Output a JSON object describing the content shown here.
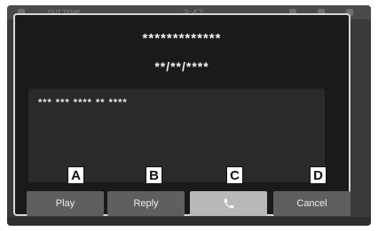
{
  "statusbar": {
    "out_temp": "OUT TEMP",
    "clock": "3:47"
  },
  "dialog": {
    "caller": "*************",
    "date": "**/**/****",
    "message": "*** *** **** ** ****"
  },
  "buttons": {
    "play": "Play",
    "reply": "Reply",
    "call_icon": "phone-icon",
    "cancel": "Cancel"
  },
  "callouts": {
    "a": "A",
    "b": "B",
    "c": "C",
    "d": "D"
  },
  "colors": {
    "dialog_bg": "#1a1a1a",
    "dialog_border": "#d8d8d8",
    "button_bg": "#5f5f5f",
    "call_button_bg": "#b8b8b8"
  }
}
